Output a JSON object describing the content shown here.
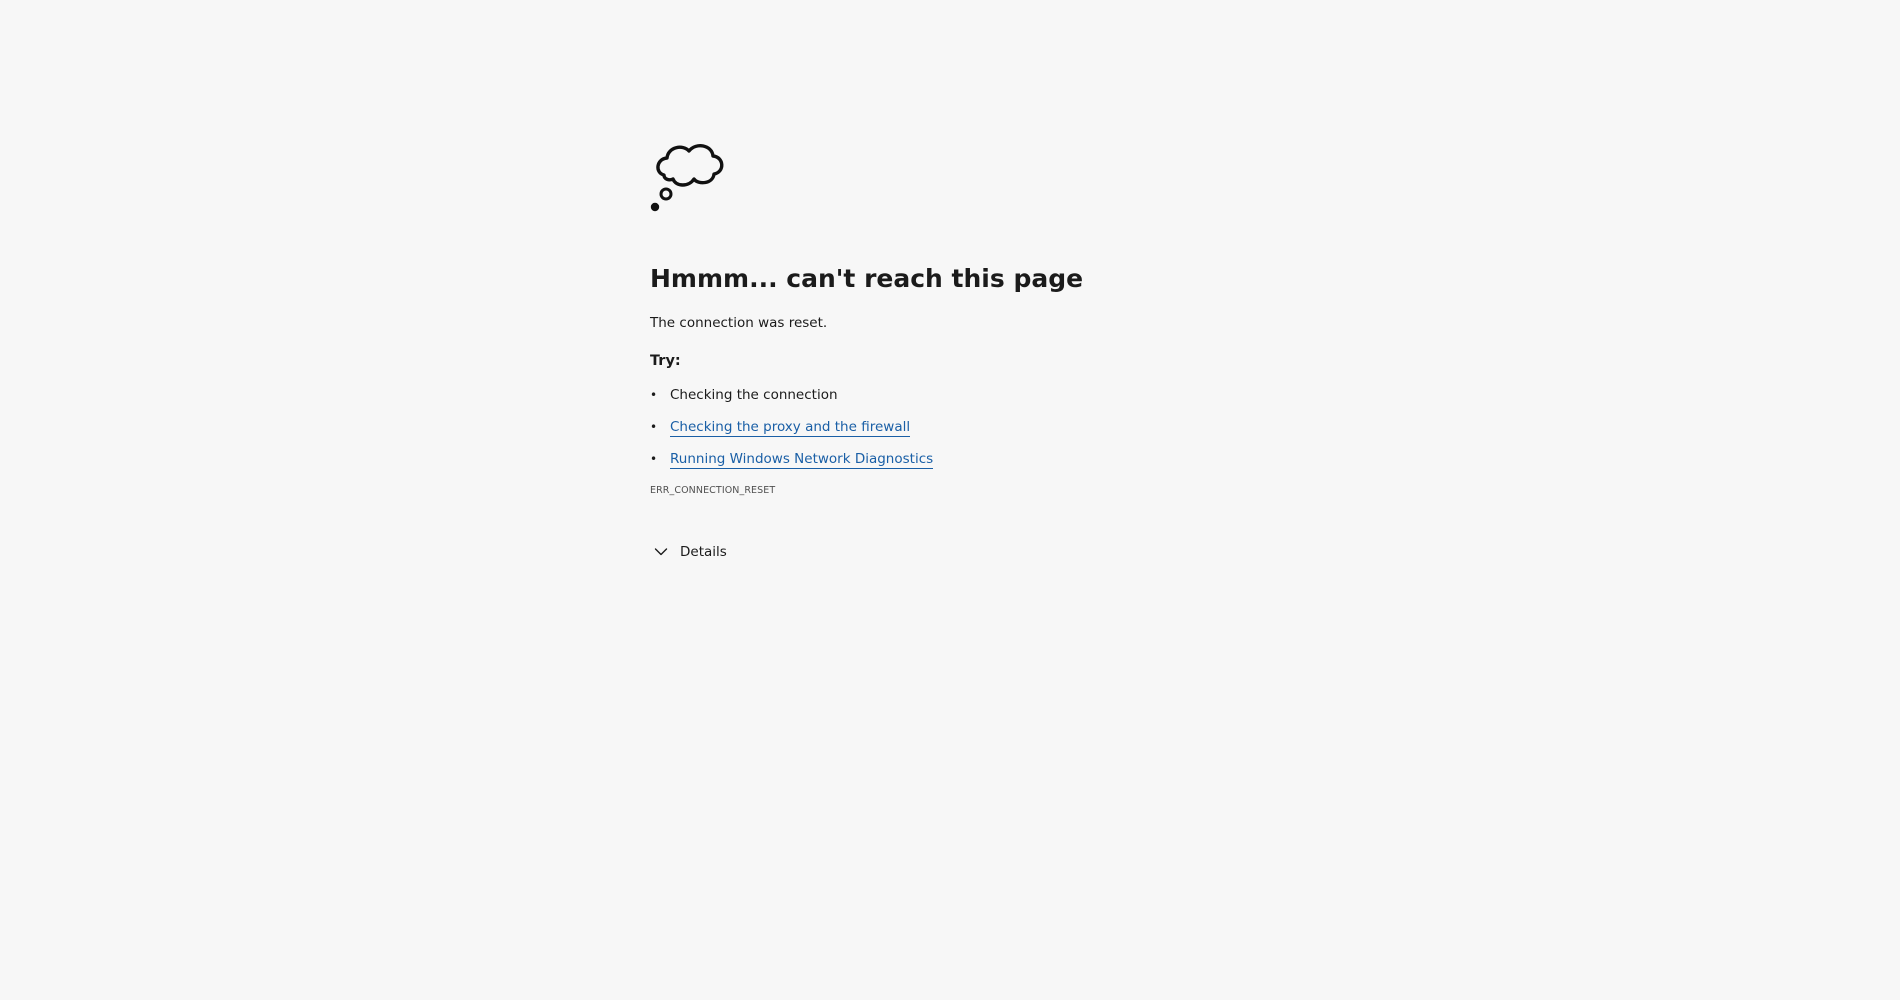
{
  "error_page": {
    "title": "Hmmm... can't reach this page",
    "message": "The connection was reset.",
    "try_label": "Try:",
    "suggestions": [
      {
        "text": "Checking the connection",
        "is_link": false
      },
      {
        "text": "Checking the proxy and the firewall",
        "is_link": true
      },
      {
        "text": "Running Windows Network Diagnostics",
        "is_link": true
      }
    ],
    "error_code": "ERR_CONNECTION_RESET",
    "details_label": "Details",
    "icon": "thought-cloud-icon",
    "details_icon": "chevron-down-icon",
    "colors": {
      "background": "#f7f7f7",
      "text": "#1b1b1b",
      "link": "#1a5fa6",
      "error_code": "#505050"
    }
  }
}
